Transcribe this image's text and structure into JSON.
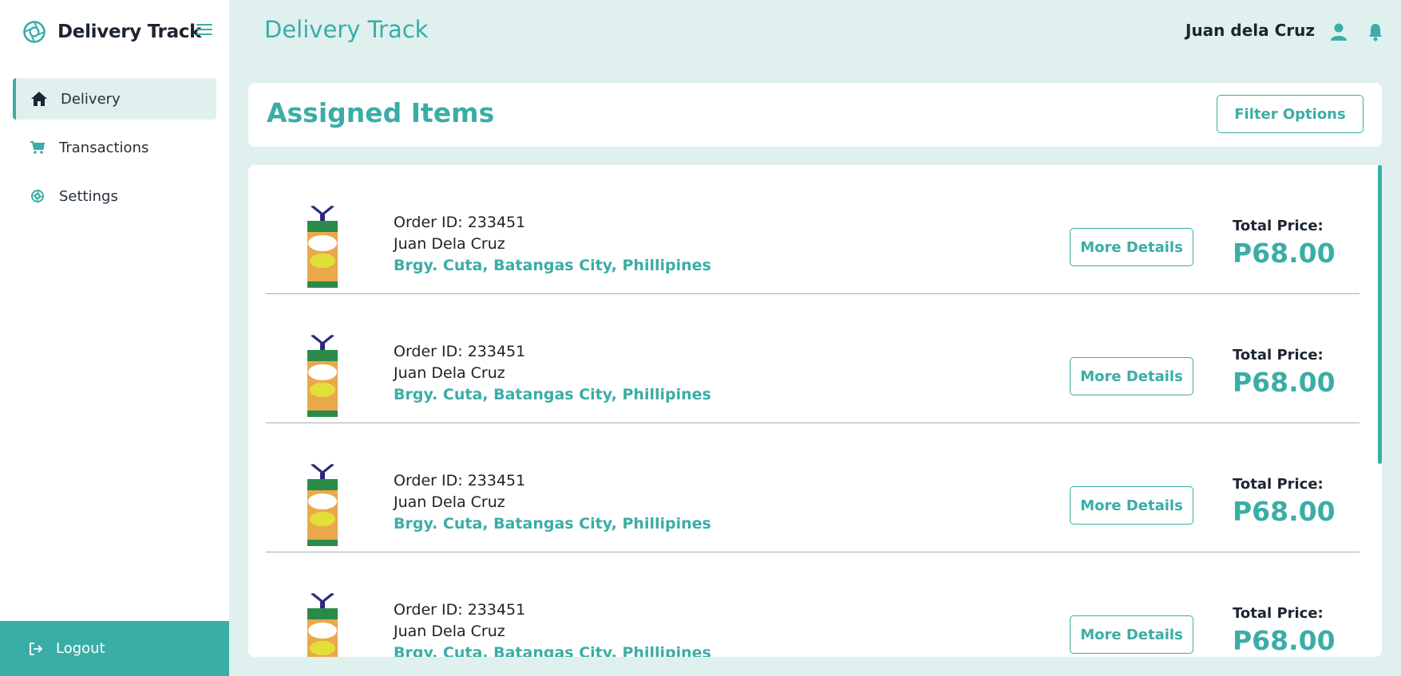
{
  "sidebar": {
    "brand_title": "Delivery Track",
    "items": [
      {
        "label": "Delivery",
        "icon": "home-icon",
        "active": true
      },
      {
        "label": "Transactions",
        "icon": "cart-icon",
        "active": false
      },
      {
        "label": "Settings",
        "icon": "gear-icon",
        "active": false
      }
    ],
    "logout_label": "Logout"
  },
  "header": {
    "title": "Delivery Track",
    "user_name": "Juan dela Cruz"
  },
  "assigned": {
    "title": "Assigned Items",
    "filter_label": "Filter Options"
  },
  "orders": [
    {
      "order_id": "Order ID: 233451",
      "customer": "Juan Dela Cruz",
      "address": "Brgy. Cuta, Batangas City, Phillipines",
      "details_label": "More Details",
      "price_label": "Total Price:",
      "price": "P68.00"
    },
    {
      "order_id": "Order ID: 233451",
      "customer": "Juan Dela Cruz",
      "address": "Brgy. Cuta, Batangas City, Phillipines",
      "details_label": "More Details",
      "price_label": "Total Price:",
      "price": "P68.00"
    },
    {
      "order_id": "Order ID: 233451",
      "customer": "Juan Dela Cruz",
      "address": "Brgy. Cuta, Batangas City, Phillipines",
      "details_label": "More Details",
      "price_label": "Total Price:",
      "price": "P68.00"
    },
    {
      "order_id": "Order ID: 233451",
      "customer": "Juan Dela Cruz",
      "address": "Brgy. Cuta, Batangas City, Phillipines",
      "details_label": "More Details",
      "price_label": "Total Price:",
      "price": "P68.00"
    }
  ],
  "colors": {
    "accent": "#3aada6",
    "background": "#dff0ef",
    "text_dark": "#1c2530"
  }
}
